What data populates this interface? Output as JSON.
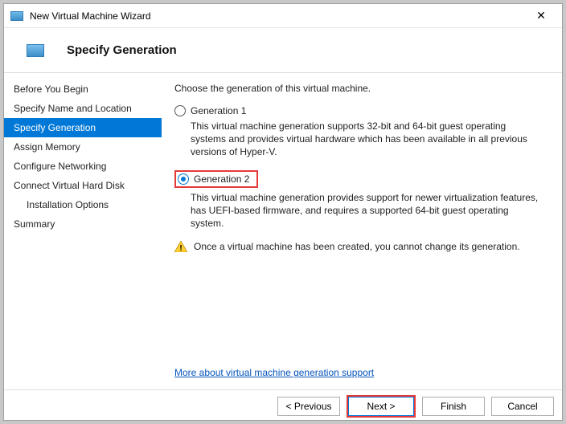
{
  "window": {
    "title": "New Virtual Machine Wizard"
  },
  "header": {
    "step_title": "Specify Generation"
  },
  "sidebar": {
    "items": [
      {
        "label": "Before You Begin"
      },
      {
        "label": "Specify Name and Location"
      },
      {
        "label": "Specify Generation"
      },
      {
        "label": "Assign Memory"
      },
      {
        "label": "Configure Networking"
      },
      {
        "label": "Connect Virtual Hard Disk"
      },
      {
        "label": "Installation Options"
      },
      {
        "label": "Summary"
      }
    ]
  },
  "content": {
    "intro": "Choose the generation of this virtual machine.",
    "gen1_label": "Generation 1",
    "gen1_desc": "This virtual machine generation supports 32-bit and 64-bit guest operating systems and provides virtual hardware which has been available in all previous versions of Hyper-V.",
    "gen2_label": "Generation 2",
    "gen2_desc": "This virtual machine generation provides support for newer virtualization features, has UEFI-based firmware, and requires a supported 64-bit guest operating system.",
    "warning": "Once a virtual machine has been created, you cannot change its generation.",
    "link": "More about virtual machine generation support"
  },
  "footer": {
    "previous": "< Previous",
    "next": "Next >",
    "finish": "Finish",
    "cancel": "Cancel"
  }
}
